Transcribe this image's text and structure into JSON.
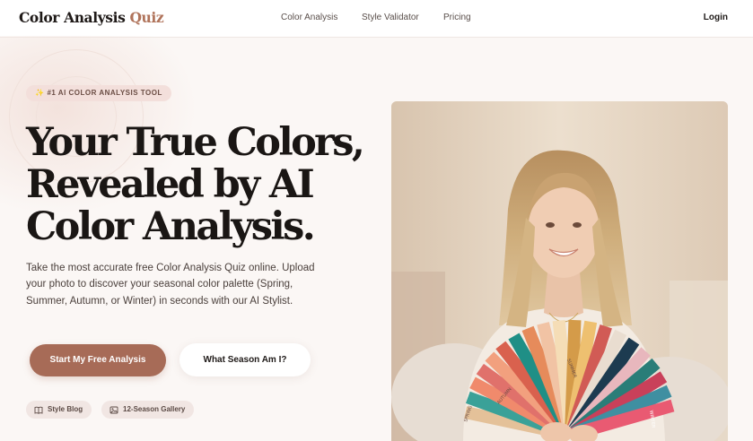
{
  "nav": {
    "logo_main": "Color Analysis ",
    "logo_accent": "Quiz",
    "links": [
      "Color Analysis",
      "Style Validator",
      "Pricing"
    ],
    "login": "Login"
  },
  "hero": {
    "badge": "#1 AI COLOR ANALYSIS TOOL",
    "badge_icon": "sparkles-icon",
    "headline_lines": [
      "Your True Colors,",
      "Revealed by AI",
      "Color Analysis."
    ],
    "description": "Take the most accurate free Color Analysis Quiz online. Upload your photo to discover your seasonal color palette (Spring, Summer, Autumn, or Winter) in seconds with our AI Stylist.",
    "primary_cta": "Start My Free Analysis",
    "secondary_cta": "What Season Am I?",
    "chips": [
      {
        "label": "Style Blog",
        "icon": "book-icon"
      },
      {
        "label": "12-Season Gallery",
        "icon": "image-icon"
      }
    ]
  },
  "colors": {
    "brand_accent": "#a76b57",
    "background": "#fbf7f5",
    "badge_bg": "#f3dfdb"
  },
  "photo": {
    "swatch_labels": [
      "AUTUMN",
      "SUMMER",
      "WINTER",
      "SPRING"
    ]
  }
}
